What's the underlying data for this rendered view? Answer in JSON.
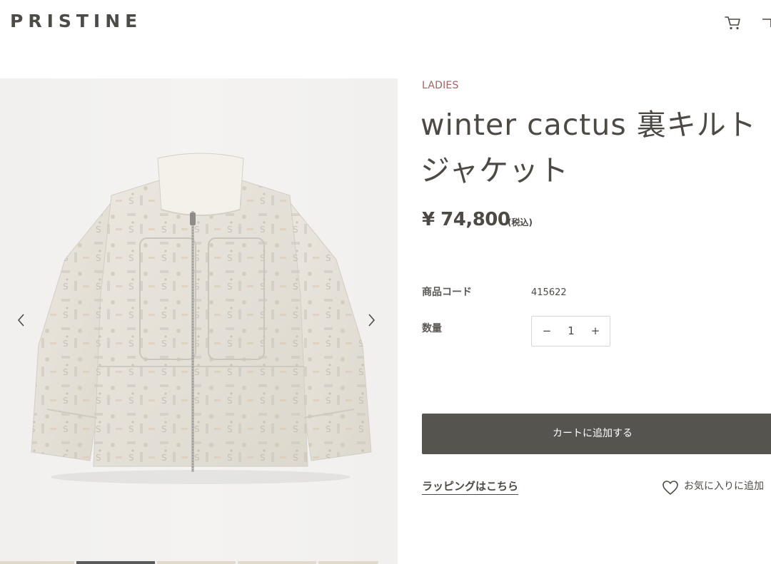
{
  "header": {
    "logo": "PRISTINE",
    "cart_icon": "cart-icon",
    "menu_icon": "menu-icon"
  },
  "gallery": {
    "image": "jacket-image",
    "prev_icon": "chevron-left-icon",
    "next_icon": "chevron-right-icon",
    "active_thumbnail_index": 1
  },
  "product": {
    "category": "LADIES",
    "title": "winter cactus 裏キルト\nジャケット",
    "price": "¥ 74,800",
    "tax_note": "(税込)",
    "code_label": "商品コード",
    "code_value": "415622",
    "quantity_label": "数量",
    "quantity_value": "1",
    "minus_label": "−",
    "plus_label": "+"
  },
  "actions": {
    "add_to_cart": "カートに追加する",
    "wrapping": "ラッピングはこちら",
    "favorite": "お気に入りに追加",
    "favorite_icon": "heart-icon"
  },
  "colors": {
    "category": "#a4625d",
    "button_bg": "#56544f",
    "text": "#4d4a45"
  }
}
